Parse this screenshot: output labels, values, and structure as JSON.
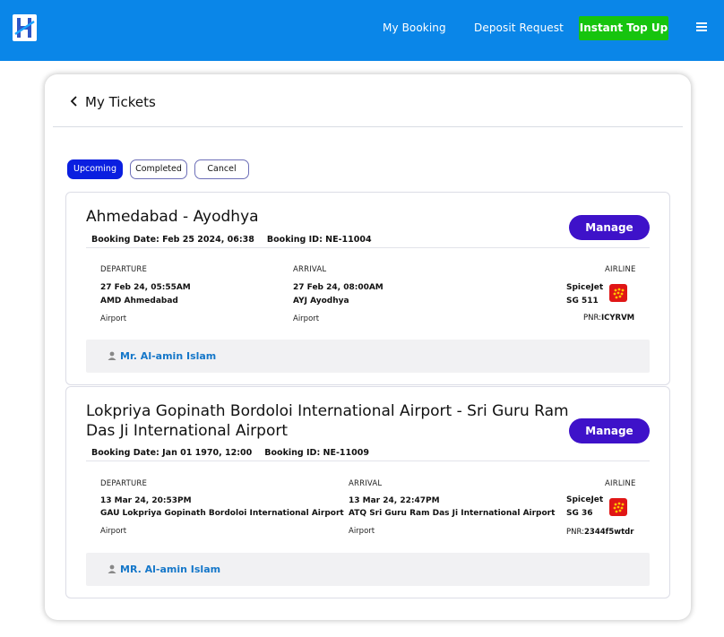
{
  "nav": {
    "my_booking": "My Booking",
    "deposit_request": "Deposit Request",
    "instant_top_up": "Instant Top Up",
    "menu_icon": "hamburger-menu-icon",
    "logo_icon": "brand-logo-icon"
  },
  "page": {
    "back_icon": "chevron-left-icon",
    "title": "My Tickets"
  },
  "tabs": [
    {
      "label": "Upcoming",
      "active": true
    },
    {
      "label": "Completed",
      "active": false
    },
    {
      "label": "Cancel",
      "active": false
    }
  ],
  "tickets": [
    {
      "route": "Ahmedabad - Ayodhya",
      "booking_date": "Booking Date: Feb 25 2024, 06:38",
      "booking_id": "Booking ID: NE-11004",
      "manage_label": "Manage",
      "departure_label": "DEPARTURE",
      "departure_time": "27 Feb 24, 05:55AM",
      "departure_place": "AMD Ahmedabad",
      "departure_type": "Airport",
      "arrival_label": "ARRIVAL",
      "arrival_time": "27 Feb 24, 08:00AM",
      "arrival_place": "AYJ Ayodhya",
      "arrival_type": "Airport",
      "airline_label": "AIRLINE",
      "airline_name": "SpiceJet",
      "flight_no": "SG 511",
      "pnr_label": "PNR:",
      "pnr": "ICYRVM",
      "passenger_icon": "user-icon",
      "passenger": "Mr. Al-amin Islam"
    },
    {
      "route": "Lokpriya Gopinath Bordoloi International Airport - Sri Guru Ram Das Ji International Airport",
      "booking_date": "Booking Date: Jan 01 1970, 12:00",
      "booking_id": "Booking ID: NE-11009",
      "manage_label": "Manage",
      "departure_label": "DEPARTURE",
      "departure_time": "13 Mar 24, 20:53PM",
      "departure_place": "GAU Lokpriya Gopinath Bordoloi International Airport",
      "departure_type": "Airport",
      "arrival_label": "ARRIVAL",
      "arrival_time": "13 Mar 24, 22:47PM",
      "arrival_place": "ATQ Sri Guru Ram Das Ji International Airport",
      "arrival_type": "Airport",
      "airline_label": "AIRLINE",
      "airline_name": "SpiceJet",
      "flight_no": "SG 36",
      "pnr_label": "PNR:",
      "pnr": "2344f5wtdr",
      "passenger_icon": "user-icon",
      "passenger": "MR. Al-amin Islam"
    }
  ],
  "colors": {
    "topbar": "#0a86e8",
    "top_up_button": "#16c40e",
    "active_tab": "#0a1fe0",
    "manage_button": "#3e12c9",
    "passenger_name": "#1577c9"
  }
}
